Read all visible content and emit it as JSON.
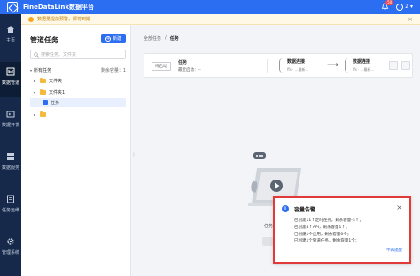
{
  "app": {
    "title": "FineDataLink数据平台",
    "notification_count": "50",
    "user_label": "2"
  },
  "banner": {
    "text": "数据量提前预警，即将到期",
    "close": "×"
  },
  "sidebar": {
    "items": [
      {
        "label": "主页",
        "icon": "home-icon"
      },
      {
        "label": "数据管道",
        "icon": "pipeline-icon"
      },
      {
        "label": "数据开发",
        "icon": "dev-icon"
      },
      {
        "label": "数据服务",
        "icon": "service-icon"
      },
      {
        "label": "任务运维",
        "icon": "ops-icon"
      },
      {
        "label": "管理系统",
        "icon": "settings-icon"
      }
    ]
  },
  "left_panel": {
    "title": "管道任务",
    "new_button": "新建",
    "search_placeholder": "搜索任务、文件夹",
    "all_tasks": "所有任务",
    "quota": "剩余容量：1",
    "tree": [
      {
        "label": "文件夹",
        "type": "folder"
      },
      {
        "label": "文件夹1",
        "type": "folder"
      },
      {
        "label": "任务",
        "type": "task"
      },
      {
        "label": "",
        "type": "folder"
      }
    ]
  },
  "main": {
    "breadcrumb": [
      "全部任务",
      "/",
      "任务"
    ],
    "card": {
      "status": "待启动",
      "name": "任务",
      "last_run_label": "最近启动：--",
      "source": {
        "title": "数据连接",
        "sub": "ffs · ...最新..."
      },
      "target": {
        "title": "数据连接",
        "sub": "ffs · ...最新..."
      }
    },
    "empty_text": "任务"
  },
  "toast": {
    "title": "容量告警",
    "close": "×",
    "lines": [
      "已创建11个定时任务，剩余容量-3个；",
      "已创建4个API，剩余容量1个；",
      "已创建1个应用，剩余容量0个；",
      "已创建1个管道任务，剩余容量1个；"
    ],
    "link": "不再提醒"
  }
}
